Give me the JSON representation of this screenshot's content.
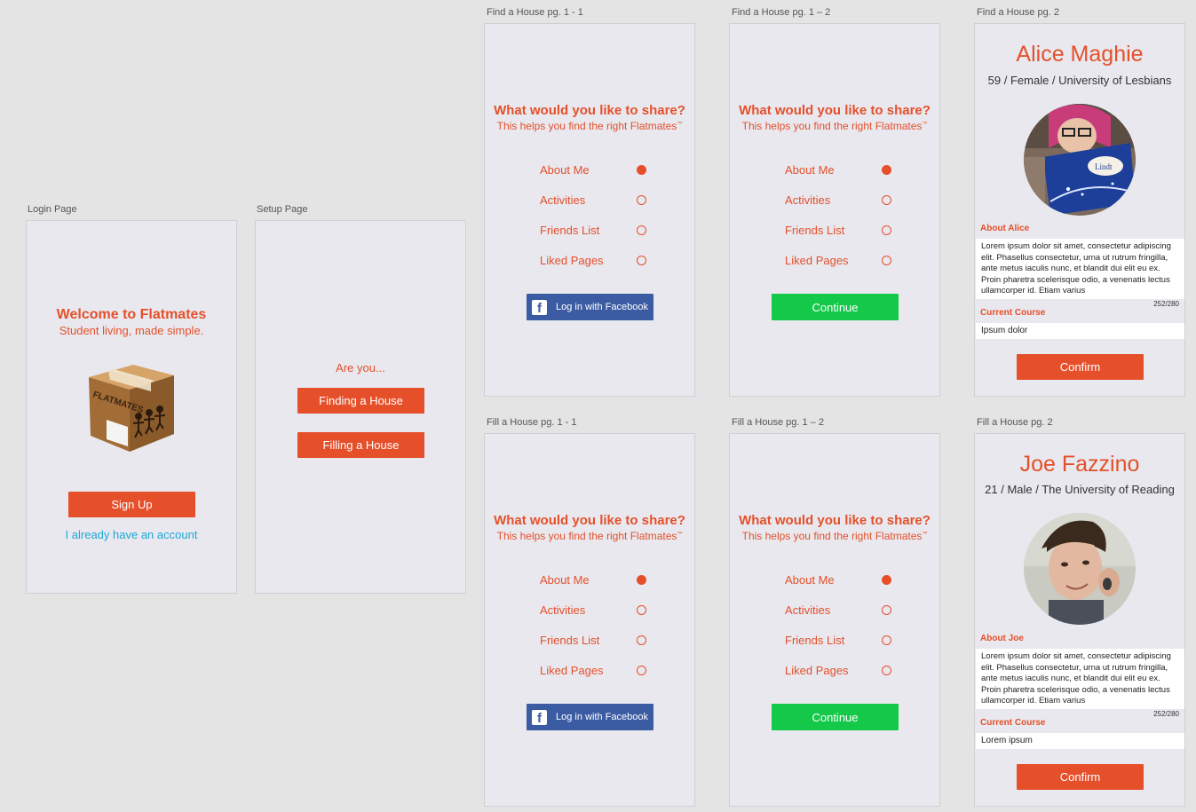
{
  "colors": {
    "accent": "#e5502b",
    "success": "#14c94a",
    "facebook": "#3b5ca3",
    "link": "#20a8d8"
  },
  "login": {
    "label": "Login Page",
    "title": "Welcome to Flatmates",
    "subtitle": "Student living, made simple.",
    "box_text": "FLATMATES",
    "signup": "Sign Up",
    "account_link": "I already have an account"
  },
  "setup": {
    "label": "Setup Page",
    "question": "Are you...",
    "finding": "Finding a House",
    "filling": "Filling a House"
  },
  "share": {
    "title": "What would you like to share?",
    "subtitle": "This helps you find the right Flatmates",
    "trademark": "™",
    "options": [
      "About Me",
      "Activities",
      "Friends List",
      "Liked Pages"
    ],
    "fb_button": "Log in with Facebook",
    "continue_button": "Continue"
  },
  "frames": {
    "find_1_1": "Find a House pg. 1 - 1",
    "find_1_2": "Find a House pg. 1 – 2",
    "find_2": "Find a House pg. 2",
    "fill_1_1": "Fill a House pg. 1 - 1",
    "fill_1_2": "Fill a House pg. 1 – 2",
    "fill_2": "Fill a House pg. 2"
  },
  "alice": {
    "name": "Alice Maghie",
    "details": "59 / Female / University of Lesbians",
    "about_label": "About Alice",
    "about_text": "Lorem ipsum dolor sit amet, consectetur adipiscing elit. Phasellus consectetur, urna ut rutrum fringilla, ante metus iaculis nunc, et blandit dui elit eu ex. Proin pharetra scelerisque odio, a venenatis lectus ullamcorper id. Etiam varius",
    "counter": "252/280",
    "course_label": "Current Course",
    "course_value": "Ipsum dolor",
    "confirm": "Confirm"
  },
  "joe": {
    "name": "Joe Fazzino",
    "details": "21 / Male / The University of Reading",
    "about_label": "About Joe",
    "about_text": "Lorem ipsum dolor sit amet, consectetur adipiscing elit. Phasellus consectetur, urna ut rutrum fringilla, ante metus iaculis nunc, et blandit dui elit eu ex. Proin pharetra scelerisque odio, a venenatis lectus ullamcorper id. Etiam varius",
    "counter": "252/280",
    "course_label": "Current Course",
    "course_value": "Lorem ipsum",
    "confirm": "Confirm"
  }
}
